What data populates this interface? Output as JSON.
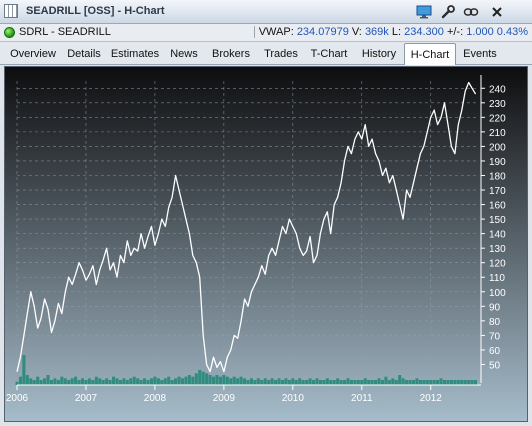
{
  "window": {
    "title": "SEADRILL [OSS] - H-Chart",
    "buttons": {
      "monitor": "monitor-icon",
      "tools": "wrench-icon",
      "link": "link-icon",
      "close": "close-icon"
    }
  },
  "status": {
    "symbol": "SDRL - SEADRILL",
    "vwap_label": "VWAP:",
    "vwap_value": "234.07979",
    "volume_label": "V:",
    "volume_value": "369k",
    "last_label": "L:",
    "last_value": "234.300",
    "change_label": "+/-:",
    "change_value": "1.000",
    "change_pct": "0.43%"
  },
  "tabs": [
    "Overview",
    "Details",
    "Estimates",
    "News",
    "Brokers",
    "Trades",
    "T-Chart",
    "History",
    "H-Chart",
    "Events"
  ],
  "active_tab": "H-Chart",
  "chart_data": {
    "type": "line",
    "title": "",
    "xlabel": "",
    "ylabel": "",
    "ylim": [
      40,
      245
    ],
    "y_ticks": [
      50,
      60,
      70,
      80,
      90,
      100,
      110,
      120,
      130,
      140,
      150,
      160,
      170,
      180,
      190,
      200,
      210,
      220,
      230,
      240
    ],
    "x_ticks": [
      "2006",
      "2007",
      "2008",
      "2009",
      "2010",
      "2011",
      "2012"
    ],
    "x_range": [
      2006.0,
      2012.7
    ],
    "grid": true,
    "series": [
      {
        "x": [
          2006.0,
          2006.05,
          2006.1,
          2006.15,
          2006.2,
          2006.25,
          2006.3,
          2006.35,
          2006.4,
          2006.45,
          2006.5,
          2006.55,
          2006.6,
          2006.65,
          2006.7,
          2006.75,
          2006.8,
          2006.85,
          2006.9,
          2006.95,
          2007.0,
          2007.05,
          2007.1,
          2007.15,
          2007.2,
          2007.25,
          2007.3,
          2007.35,
          2007.4,
          2007.45,
          2007.5,
          2007.55,
          2007.6,
          2007.65,
          2007.7,
          2007.75,
          2007.8,
          2007.85,
          2007.9,
          2007.95,
          2008.0,
          2008.05,
          2008.1,
          2008.15,
          2008.2,
          2008.25,
          2008.3,
          2008.35,
          2008.4,
          2008.45,
          2008.5,
          2008.55,
          2008.6,
          2008.65,
          2008.7,
          2008.75,
          2008.8,
          2008.85,
          2008.9,
          2008.95,
          2009.0,
          2009.05,
          2009.1,
          2009.15,
          2009.2,
          2009.25,
          2009.3,
          2009.35,
          2009.4,
          2009.45,
          2009.5,
          2009.55,
          2009.6,
          2009.65,
          2009.7,
          2009.75,
          2009.8,
          2009.85,
          2009.9,
          2009.95,
          2010.0,
          2010.05,
          2010.1,
          2010.15,
          2010.2,
          2010.25,
          2010.3,
          2010.35,
          2010.4,
          2010.45,
          2010.5,
          2010.55,
          2010.6,
          2010.65,
          2010.7,
          2010.75,
          2010.8,
          2010.85,
          2010.9,
          2010.95,
          2011.0,
          2011.05,
          2011.1,
          2011.15,
          2011.2,
          2011.25,
          2011.3,
          2011.35,
          2011.4,
          2011.45,
          2011.5,
          2011.55,
          2011.6,
          2011.65,
          2011.7,
          2011.75,
          2011.8,
          2011.85,
          2011.9,
          2011.95,
          2012.0,
          2012.05,
          2012.1,
          2012.15,
          2012.2,
          2012.25,
          2012.3,
          2012.35,
          2012.4,
          2012.45,
          2012.5,
          2012.55,
          2012.6,
          2012.65
        ],
        "values": [
          45,
          55,
          70,
          85,
          100,
          90,
          75,
          82,
          95,
          88,
          72,
          80,
          92,
          85,
          100,
          110,
          105,
          112,
          120,
          115,
          108,
          112,
          118,
          105,
          115,
          122,
          130,
          115,
          120,
          110,
          125,
          120,
          135,
          125,
          130,
          128,
          140,
          130,
          138,
          145,
          132,
          140,
          150,
          145,
          158,
          165,
          180,
          170,
          160,
          150,
          140,
          125,
          120,
          110,
          70,
          50,
          45,
          55,
          48,
          52,
          45,
          55,
          60,
          70,
          68,
          80,
          95,
          90,
          100,
          105,
          110,
          118,
          112,
          125,
          130,
          125,
          135,
          145,
          140,
          150,
          145,
          140,
          130,
          125,
          128,
          138,
          120,
          125,
          140,
          150,
          155,
          140,
          160,
          165,
          175,
          190,
          200,
          195,
          205,
          210,
          205,
          215,
          200,
          205,
          195,
          190,
          180,
          185,
          175,
          180,
          170,
          160,
          150,
          170,
          165,
          175,
          185,
          195,
          200,
          210,
          220,
          225,
          215,
          220,
          230,
          215,
          200,
          195,
          215,
          225,
          238,
          244,
          240,
          236
        ]
      }
    ],
    "volume_values": [
      2,
      5,
      18,
      6,
      4,
      3,
      5,
      3,
      4,
      6,
      3,
      4,
      3,
      5,
      4,
      3,
      4,
      5,
      3,
      4,
      3,
      4,
      3,
      5,
      4,
      3,
      4,
      3,
      5,
      4,
      3,
      4,
      3,
      4,
      5,
      4,
      3,
      4,
      3,
      4,
      5,
      4,
      3,
      4,
      5,
      3,
      4,
      5,
      4,
      5,
      6,
      5,
      7,
      9,
      8,
      7,
      6,
      5,
      6,
      5,
      6,
      5,
      4,
      5,
      4,
      5,
      4,
      3,
      4,
      3,
      4,
      3,
      4,
      3,
      4,
      3,
      4,
      3,
      4,
      3,
      4,
      3,
      4,
      3,
      3,
      4,
      3,
      4,
      3,
      3,
      4,
      3,
      3,
      4,
      3,
      3,
      4,
      3,
      3,
      3,
      3,
      4,
      3,
      3,
      3,
      4,
      3,
      5,
      3,
      4,
      3,
      6,
      4,
      3,
      3,
      3,
      4,
      3,
      3,
      3,
      3,
      3,
      3,
      4,
      3,
      3,
      3,
      3,
      3,
      3,
      3,
      3,
      3,
      3
    ],
    "colors": {
      "background_top": "#0d0d0f",
      "background_bottom": "#a6bcca",
      "price_line": "#ffffff",
      "volume": "#2f8c7f",
      "grid": "#8ea0b0",
      "axis_text": "#ffffff"
    }
  }
}
